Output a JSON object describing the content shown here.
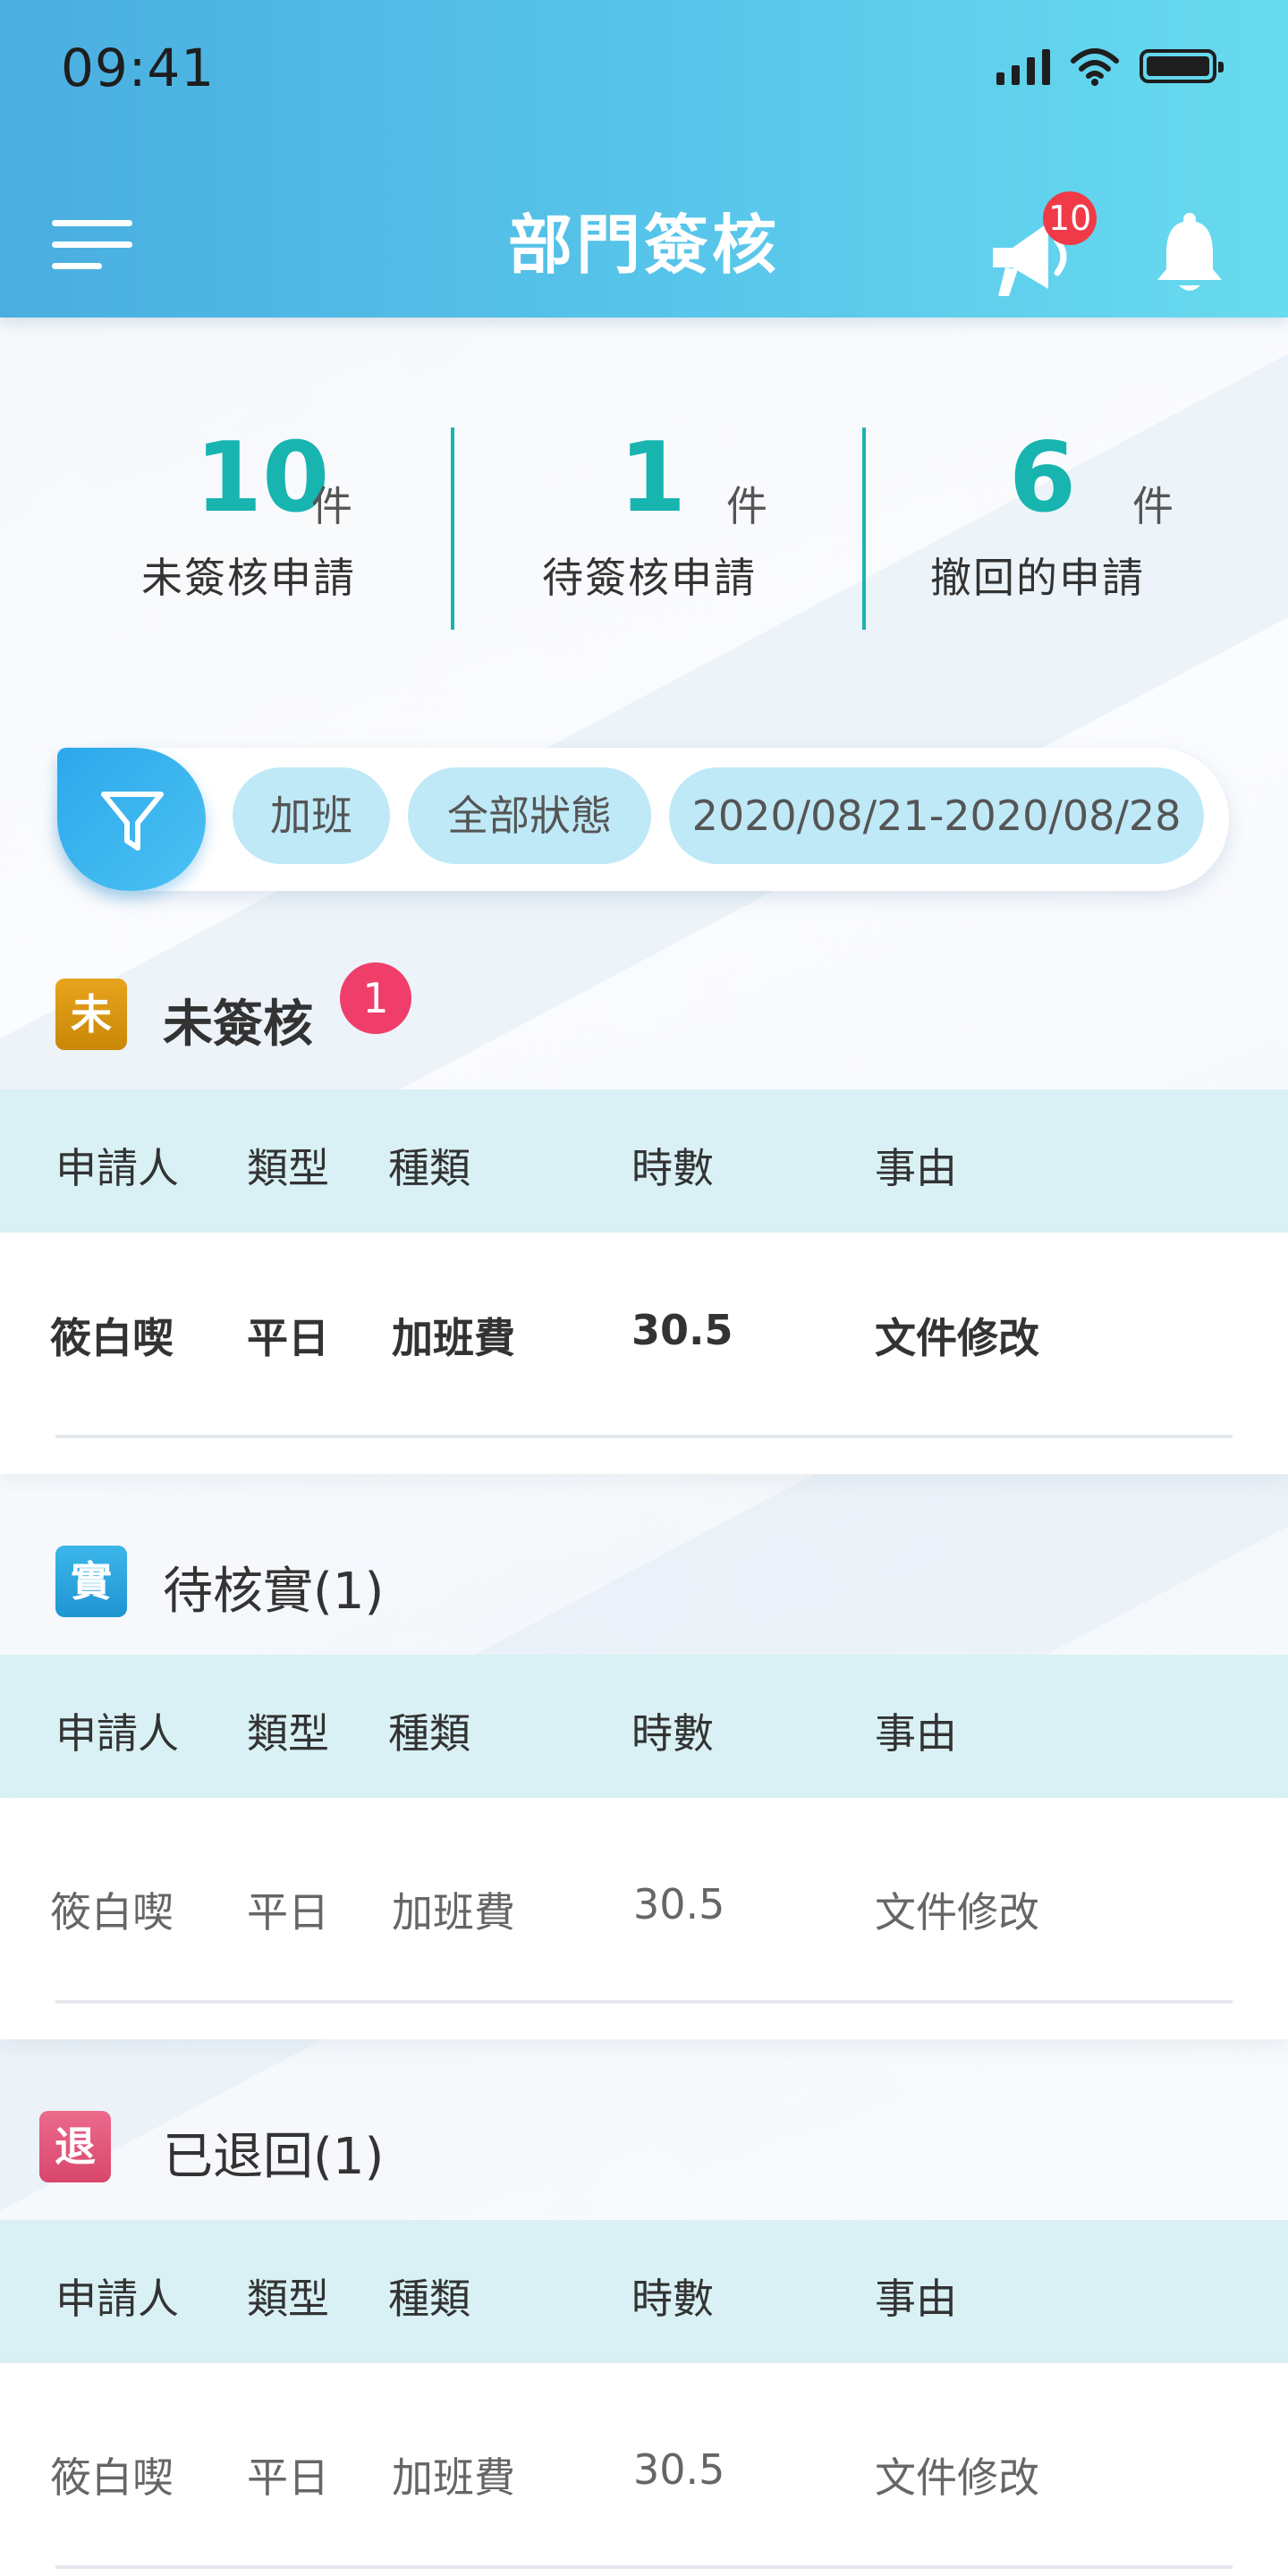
{
  "status_bar": {
    "time": "09:41"
  },
  "header": {
    "title": "部門簽核",
    "notification_count": "10"
  },
  "summary": [
    {
      "number": "10",
      "unit": "件",
      "label": "未簽核申請"
    },
    {
      "number": "1",
      "unit": "件",
      "label": "待簽核申請"
    },
    {
      "number": "6",
      "unit": "件",
      "label": "撤回的申請"
    }
  ],
  "filters": {
    "type": "加班",
    "status": "全部狀態",
    "date_range": "2020/08/21-2020/08/28"
  },
  "columns": [
    "申請人",
    "類型",
    "種類",
    "時數",
    "事由"
  ],
  "sections": [
    {
      "icon_char": "未",
      "icon_color": "#d49412",
      "title": "未簽核",
      "count": "1",
      "rows": [
        {
          "applicant": "筱白喫",
          "type": "平日",
          "kind": "加班費",
          "hours": "30.5",
          "reason": "文件修改"
        }
      ]
    },
    {
      "icon_char": "實",
      "icon_color": "#2ca6df",
      "title": "待核實(1)",
      "rows": [
        {
          "applicant": "筱白喫",
          "type": "平日",
          "kind": "加班費",
          "hours": "30.5",
          "reason": "文件修改"
        }
      ]
    },
    {
      "icon_char": "退",
      "icon_color": "#e0567a",
      "title": "已退回(1)",
      "rows": [
        {
          "applicant": "筱白喫",
          "type": "平日",
          "kind": "加班費",
          "hours": "30.5",
          "reason": "文件修改"
        }
      ]
    }
  ],
  "colors": {
    "header_start": "#4aaee0",
    "header_end": "#68dbef",
    "accent_teal": "#18b4b0",
    "chip_bg": "#bfe9f7",
    "table_head_bg": "#d9f1f5",
    "badge_red": "#f03a47"
  }
}
